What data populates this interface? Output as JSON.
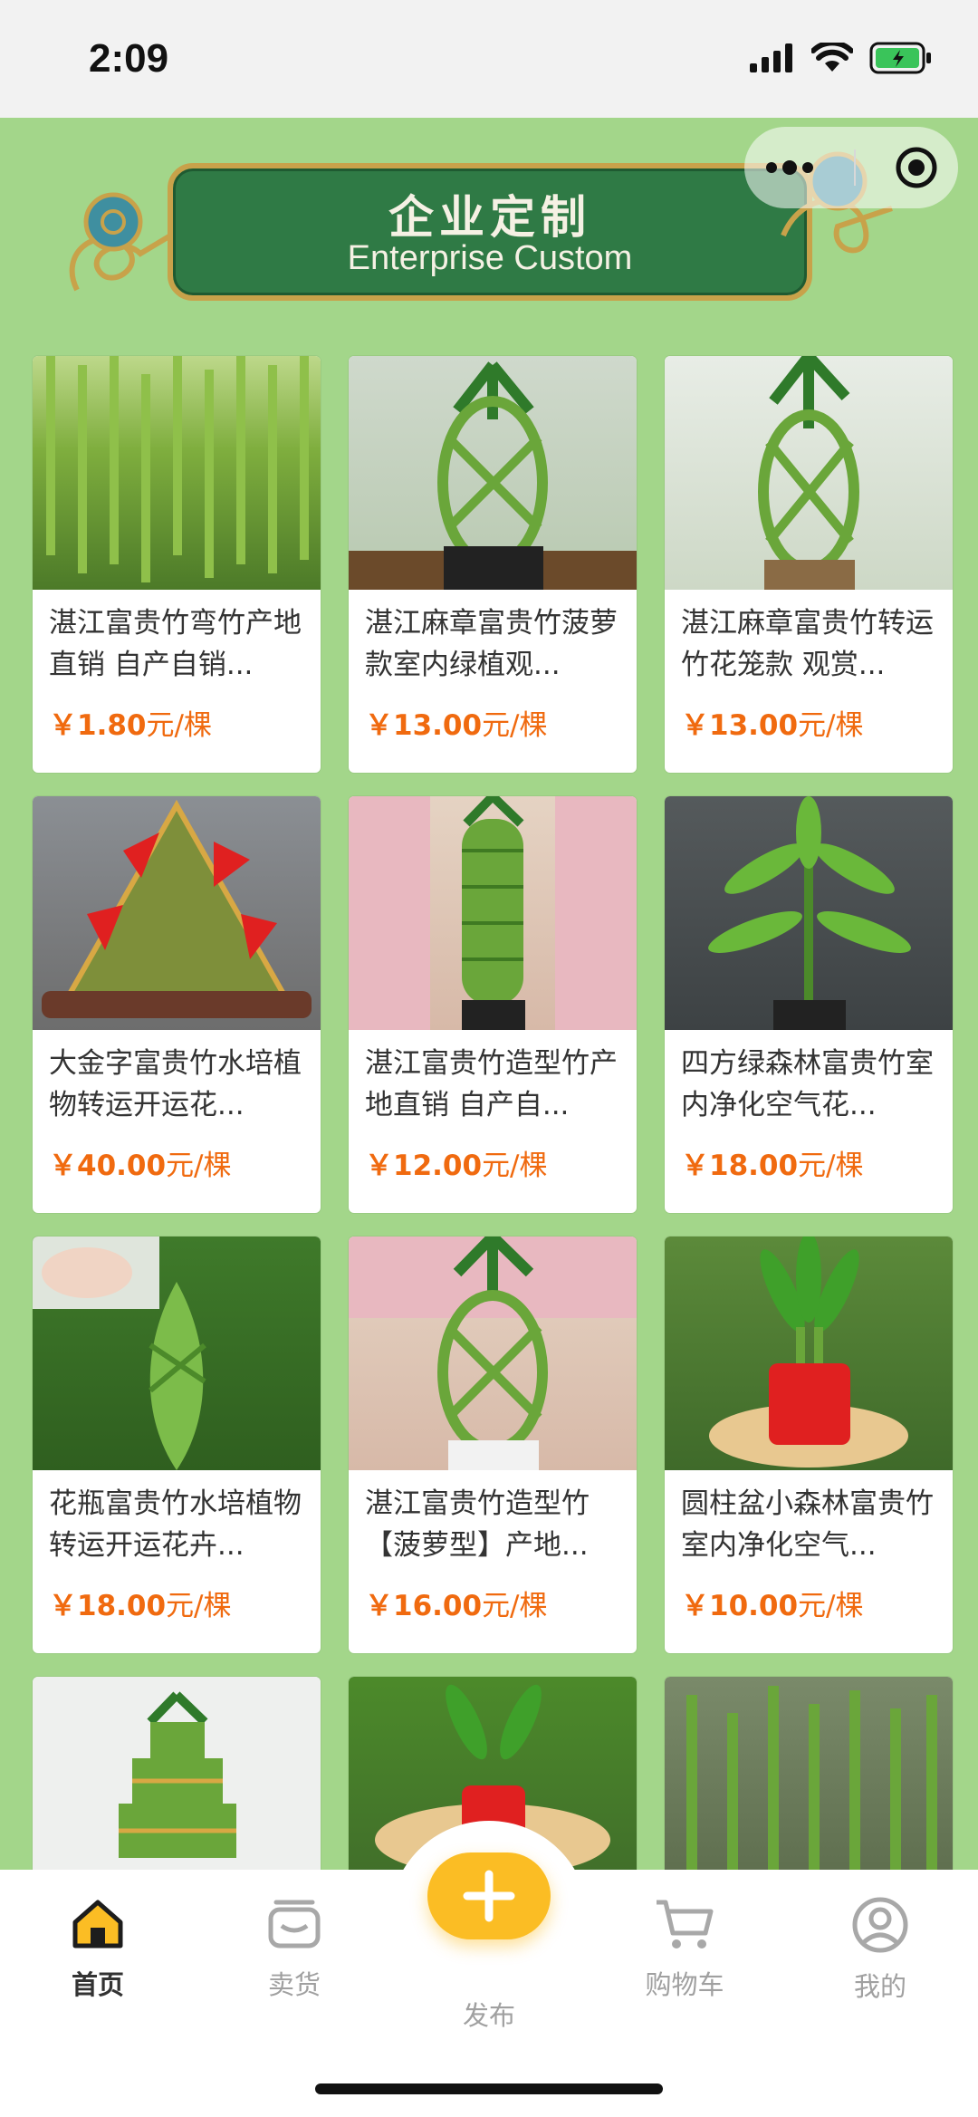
{
  "status_bar": {
    "time": "2:09"
  },
  "banner": {
    "title_cn": "企业定制",
    "title_en": "Enterprise Custom"
  },
  "products": [
    {
      "title": "湛江富贵竹弯竹产地直销 自产自销...",
      "price_symbol": "￥",
      "price": "1.80",
      "unit": "元/棵"
    },
    {
      "title": "湛江麻章富贵竹菠萝款室内绿植观...",
      "price_symbol": "￥",
      "price": "13.00",
      "unit": "元/棵"
    },
    {
      "title": "湛江麻章富贵竹转运竹花笼款 观赏...",
      "price_symbol": "￥",
      "price": "13.00",
      "unit": "元/棵"
    },
    {
      "title": "大金字富贵竹水培植物转运开运花...",
      "price_symbol": "￥",
      "price": "40.00",
      "unit": "元/棵"
    },
    {
      "title": "湛江富贵竹造型竹产地直销 自产自...",
      "price_symbol": "￥",
      "price": "12.00",
      "unit": "元/棵"
    },
    {
      "title": "四方绿森林富贵竹室内净化空气花...",
      "price_symbol": "￥",
      "price": "18.00",
      "unit": "元/棵"
    },
    {
      "title": "花瓶富贵竹水培植物转运开运花卉...",
      "price_symbol": "￥",
      "price": "18.00",
      "unit": "元/棵"
    },
    {
      "title": "湛江富贵竹造型竹【菠萝型】产地...",
      "price_symbol": "￥",
      "price": "16.00",
      "unit": "元/棵"
    },
    {
      "title": "圆柱盆小森林富贵竹室内净化空气...",
      "price_symbol": "￥",
      "price": "10.00",
      "unit": "元/棵"
    }
  ],
  "tabbar": {
    "home": "首页",
    "sell": "卖货",
    "publish": "发布",
    "cart": "购物车",
    "mine": "我的"
  },
  "colors": {
    "accent": "#fbbd24",
    "price": "#f06a0f",
    "background": "#a3d68a",
    "banner": "#2f7a45"
  },
  "icons": [
    "home-icon",
    "sell-icon",
    "plus-icon",
    "cart-icon",
    "user-icon",
    "more-icon",
    "record-icon",
    "signal-icon",
    "wifi-icon",
    "battery-icon"
  ]
}
